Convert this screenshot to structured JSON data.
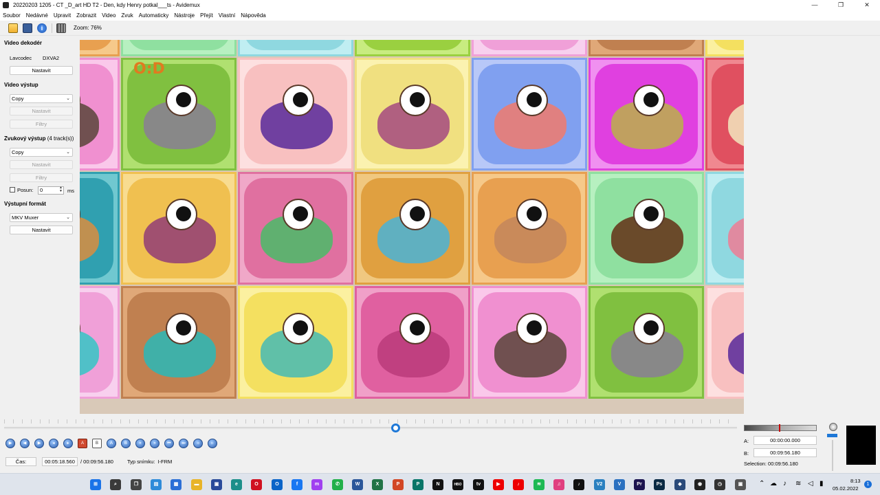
{
  "window": {
    "title": "20220203 1205 - CT _D_art HD T2 - Den, kdy Henry potkal___ts - Avidemux",
    "minimize": "—",
    "maximize": "❐",
    "close": "✕"
  },
  "menu": [
    "Soubor",
    "Nedávné",
    "Upravit",
    "Zobrazit",
    "Video",
    "Zvuk",
    "Automaticky",
    "Nástroje",
    "Přejít",
    "Vlastní",
    "Nápověda"
  ],
  "toolbar": {
    "zoom_label": "Zoom: 76%"
  },
  "left_panel": {
    "video_decoder": {
      "title": "Video dekodér",
      "codec_label": "Lavcodec",
      "codec_value": "DXVA2",
      "configure": "Nastavit"
    },
    "video_output": {
      "title": "Video výstup",
      "codec": "Copy",
      "configure": "Nastavit",
      "filters": "Filtry"
    },
    "audio_output": {
      "title": "Zvukový výstup",
      "tracks": "(4 track(s))",
      "codec": "Copy",
      "configure": "Nastavit",
      "filters": "Filtry",
      "shift_label": "Posun:",
      "shift_value": "0",
      "shift_unit": "ms"
    },
    "output_format": {
      "title": "Výstupní formát",
      "muxer": "MKV Muxer",
      "configure": "Nastavit"
    }
  },
  "video": {
    "logo_text": "O:D"
  },
  "playback": {
    "time_label": "Čas:",
    "current_time": "00:05:18.560",
    "total_time": "/ 00:09:56.180",
    "frame_type_label": "Typ snímku:",
    "frame_type": "I-FRM",
    "position_fraction": 0.5336
  },
  "markers": {
    "a_label": "A:",
    "a_value": "00:00:00.000",
    "b_label": "B:",
    "b_value": "00:09:56.180",
    "selection": "Selection: 00:09:56.180"
  },
  "taskbar": {
    "clock_time": "8:13",
    "clock_date": "05.02.2022",
    "notification_count": "1",
    "apps": [
      {
        "name": "start",
        "color": "#1a73e8",
        "glyph": "⊞"
      },
      {
        "name": "search",
        "color": "#3a3a3a",
        "glyph": "⌕"
      },
      {
        "name": "task-view",
        "color": "#444",
        "glyph": "❐"
      },
      {
        "name": "widgets",
        "color": "#2e8bd9",
        "glyph": "▤"
      },
      {
        "name": "store",
        "color": "#2b6fd6",
        "glyph": "▦"
      },
      {
        "name": "explorer",
        "color": "#e8b428",
        "glyph": "▬"
      },
      {
        "name": "avidemux",
        "color": "#2a4a9a",
        "glyph": "▣"
      },
      {
        "name": "edge",
        "color": "#1c8f8a",
        "glyph": "e"
      },
      {
        "name": "opera",
        "color": "#d01020",
        "glyph": "O"
      },
      {
        "name": "outlook",
        "color": "#0a64c8",
        "glyph": "O"
      },
      {
        "name": "facebook",
        "color": "#1877f2",
        "glyph": "f"
      },
      {
        "name": "messenger",
        "color": "#a040f0",
        "glyph": "m"
      },
      {
        "name": "whatsapp",
        "color": "#22b04a",
        "glyph": "✆"
      },
      {
        "name": "word",
        "color": "#2b579a",
        "glyph": "W"
      },
      {
        "name": "excel",
        "color": "#217346",
        "glyph": "X"
      },
      {
        "name": "powerpoint",
        "color": "#d24726",
        "glyph": "P"
      },
      {
        "name": "publisher",
        "color": "#077568",
        "glyph": "P"
      },
      {
        "name": "netflix",
        "color": "#111",
        "glyph": "N"
      },
      {
        "name": "hbo-go",
        "color": "#111",
        "glyph": "HBO"
      },
      {
        "name": "apple-tv",
        "color": "#111",
        "glyph": "tv"
      },
      {
        "name": "youtube",
        "color": "#e00",
        "glyph": "▶"
      },
      {
        "name": "youtube-music",
        "color": "#e00",
        "glyph": "♪"
      },
      {
        "name": "spotify",
        "color": "#1db954",
        "glyph": "≋"
      },
      {
        "name": "itunes",
        "color": "#e04080",
        "glyph": "♫"
      },
      {
        "name": "tiktok",
        "color": "#111",
        "glyph": "♪"
      },
      {
        "name": "vegas",
        "color": "#2a80c0",
        "glyph": "V2"
      },
      {
        "name": "vpn",
        "color": "#2a70c0",
        "glyph": "V"
      },
      {
        "name": "premiere",
        "color": "#1c1450",
        "glyph": "Pr"
      },
      {
        "name": "photoshop",
        "color": "#0a2a44",
        "glyph": "Ps"
      },
      {
        "name": "app-a",
        "color": "#2a4a7a",
        "glyph": "◆"
      },
      {
        "name": "obs",
        "color": "#222",
        "glyph": "◉"
      },
      {
        "name": "clock-app",
        "color": "#333",
        "glyph": "◷"
      },
      {
        "name": "avidemux-active",
        "color": "#555",
        "glyph": "▣"
      }
    ]
  }
}
